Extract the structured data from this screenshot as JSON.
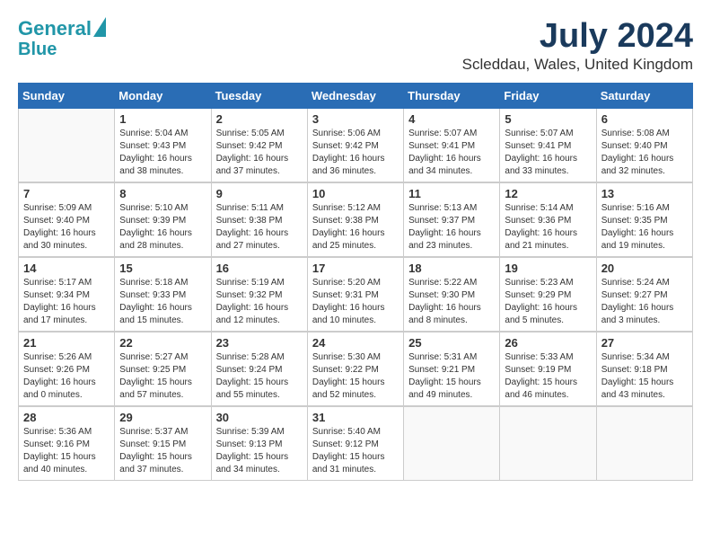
{
  "header": {
    "logo_line1": "General",
    "logo_line2": "Blue",
    "month": "July 2024",
    "location": "Scleddau, Wales, United Kingdom"
  },
  "days_of_week": [
    "Sunday",
    "Monday",
    "Tuesday",
    "Wednesday",
    "Thursday",
    "Friday",
    "Saturday"
  ],
  "weeks": [
    [
      {
        "day": "",
        "info": ""
      },
      {
        "day": "1",
        "info": "Sunrise: 5:04 AM\nSunset: 9:43 PM\nDaylight: 16 hours\nand 38 minutes."
      },
      {
        "day": "2",
        "info": "Sunrise: 5:05 AM\nSunset: 9:42 PM\nDaylight: 16 hours\nand 37 minutes."
      },
      {
        "day": "3",
        "info": "Sunrise: 5:06 AM\nSunset: 9:42 PM\nDaylight: 16 hours\nand 36 minutes."
      },
      {
        "day": "4",
        "info": "Sunrise: 5:07 AM\nSunset: 9:41 PM\nDaylight: 16 hours\nand 34 minutes."
      },
      {
        "day": "5",
        "info": "Sunrise: 5:07 AM\nSunset: 9:41 PM\nDaylight: 16 hours\nand 33 minutes."
      },
      {
        "day": "6",
        "info": "Sunrise: 5:08 AM\nSunset: 9:40 PM\nDaylight: 16 hours\nand 32 minutes."
      }
    ],
    [
      {
        "day": "7",
        "info": "Sunrise: 5:09 AM\nSunset: 9:40 PM\nDaylight: 16 hours\nand 30 minutes."
      },
      {
        "day": "8",
        "info": "Sunrise: 5:10 AM\nSunset: 9:39 PM\nDaylight: 16 hours\nand 28 minutes."
      },
      {
        "day": "9",
        "info": "Sunrise: 5:11 AM\nSunset: 9:38 PM\nDaylight: 16 hours\nand 27 minutes."
      },
      {
        "day": "10",
        "info": "Sunrise: 5:12 AM\nSunset: 9:38 PM\nDaylight: 16 hours\nand 25 minutes."
      },
      {
        "day": "11",
        "info": "Sunrise: 5:13 AM\nSunset: 9:37 PM\nDaylight: 16 hours\nand 23 minutes."
      },
      {
        "day": "12",
        "info": "Sunrise: 5:14 AM\nSunset: 9:36 PM\nDaylight: 16 hours\nand 21 minutes."
      },
      {
        "day": "13",
        "info": "Sunrise: 5:16 AM\nSunset: 9:35 PM\nDaylight: 16 hours\nand 19 minutes."
      }
    ],
    [
      {
        "day": "14",
        "info": "Sunrise: 5:17 AM\nSunset: 9:34 PM\nDaylight: 16 hours\nand 17 minutes."
      },
      {
        "day": "15",
        "info": "Sunrise: 5:18 AM\nSunset: 9:33 PM\nDaylight: 16 hours\nand 15 minutes."
      },
      {
        "day": "16",
        "info": "Sunrise: 5:19 AM\nSunset: 9:32 PM\nDaylight: 16 hours\nand 12 minutes."
      },
      {
        "day": "17",
        "info": "Sunrise: 5:20 AM\nSunset: 9:31 PM\nDaylight: 16 hours\nand 10 minutes."
      },
      {
        "day": "18",
        "info": "Sunrise: 5:22 AM\nSunset: 9:30 PM\nDaylight: 16 hours\nand 8 minutes."
      },
      {
        "day": "19",
        "info": "Sunrise: 5:23 AM\nSunset: 9:29 PM\nDaylight: 16 hours\nand 5 minutes."
      },
      {
        "day": "20",
        "info": "Sunrise: 5:24 AM\nSunset: 9:27 PM\nDaylight: 16 hours\nand 3 minutes."
      }
    ],
    [
      {
        "day": "21",
        "info": "Sunrise: 5:26 AM\nSunset: 9:26 PM\nDaylight: 16 hours\nand 0 minutes."
      },
      {
        "day": "22",
        "info": "Sunrise: 5:27 AM\nSunset: 9:25 PM\nDaylight: 15 hours\nand 57 minutes."
      },
      {
        "day": "23",
        "info": "Sunrise: 5:28 AM\nSunset: 9:24 PM\nDaylight: 15 hours\nand 55 minutes."
      },
      {
        "day": "24",
        "info": "Sunrise: 5:30 AM\nSunset: 9:22 PM\nDaylight: 15 hours\nand 52 minutes."
      },
      {
        "day": "25",
        "info": "Sunrise: 5:31 AM\nSunset: 9:21 PM\nDaylight: 15 hours\nand 49 minutes."
      },
      {
        "day": "26",
        "info": "Sunrise: 5:33 AM\nSunset: 9:19 PM\nDaylight: 15 hours\nand 46 minutes."
      },
      {
        "day": "27",
        "info": "Sunrise: 5:34 AM\nSunset: 9:18 PM\nDaylight: 15 hours\nand 43 minutes."
      }
    ],
    [
      {
        "day": "28",
        "info": "Sunrise: 5:36 AM\nSunset: 9:16 PM\nDaylight: 15 hours\nand 40 minutes."
      },
      {
        "day": "29",
        "info": "Sunrise: 5:37 AM\nSunset: 9:15 PM\nDaylight: 15 hours\nand 37 minutes."
      },
      {
        "day": "30",
        "info": "Sunrise: 5:39 AM\nSunset: 9:13 PM\nDaylight: 15 hours\nand 34 minutes."
      },
      {
        "day": "31",
        "info": "Sunrise: 5:40 AM\nSunset: 9:12 PM\nDaylight: 15 hours\nand 31 minutes."
      },
      {
        "day": "",
        "info": ""
      },
      {
        "day": "",
        "info": ""
      },
      {
        "day": "",
        "info": ""
      }
    ]
  ]
}
